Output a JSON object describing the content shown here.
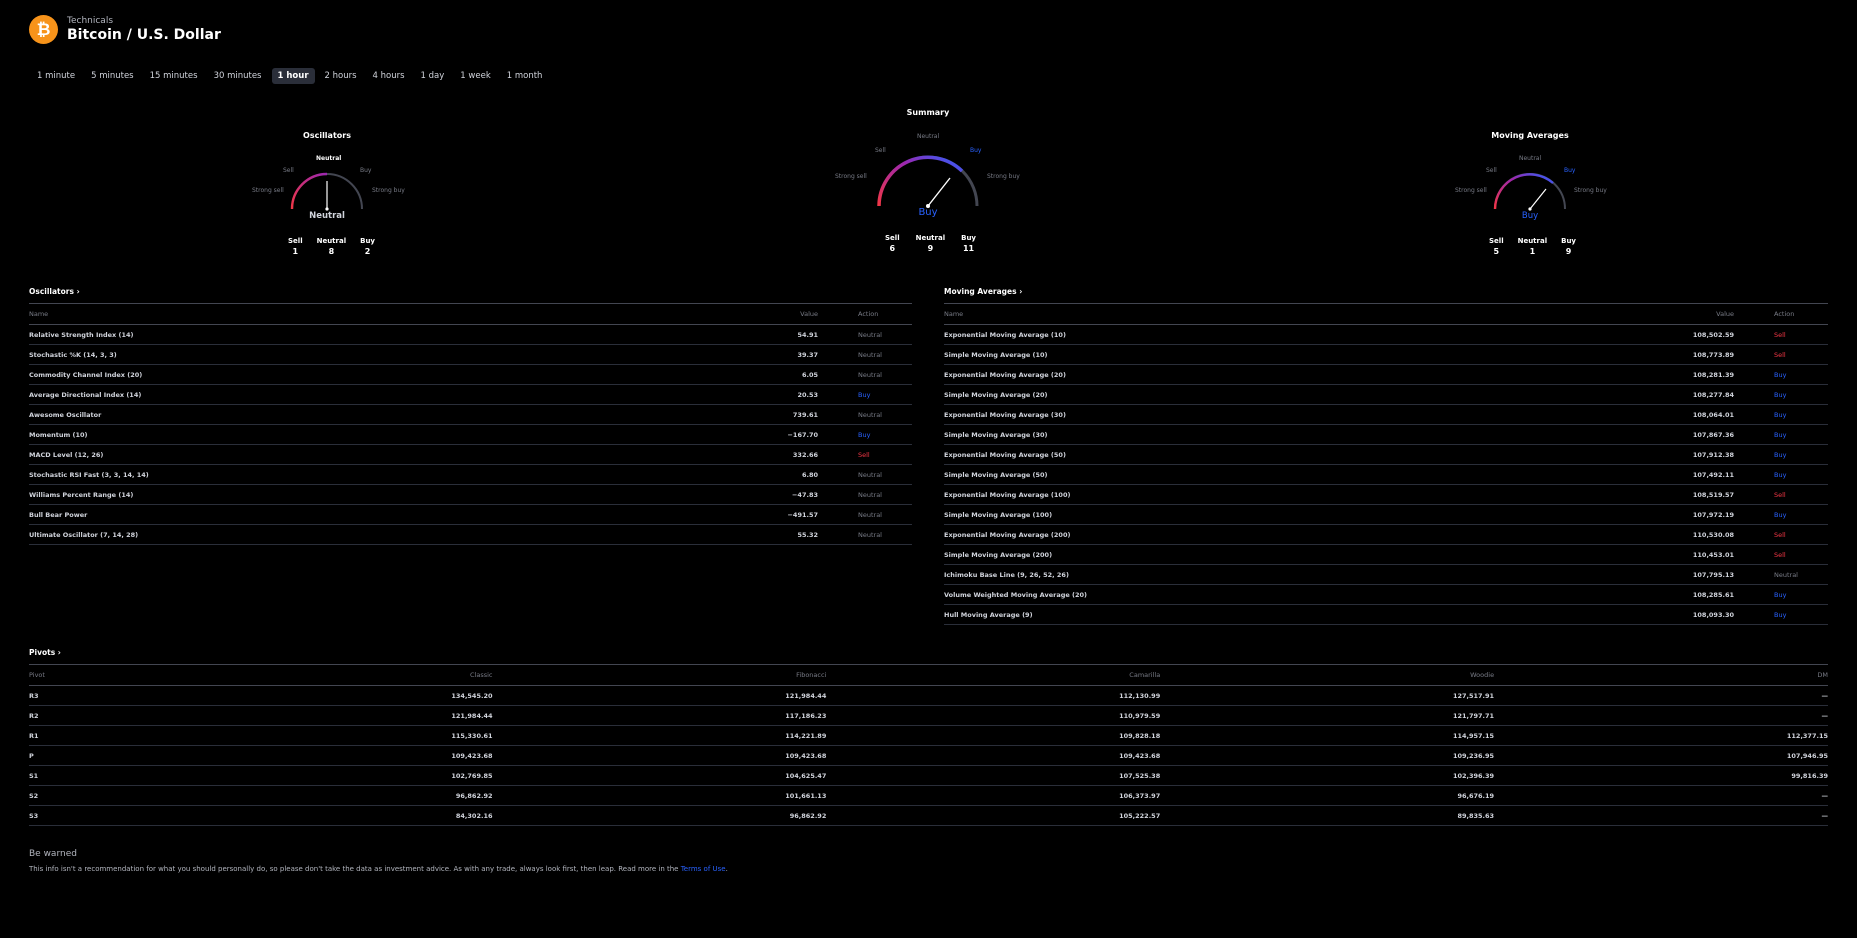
{
  "header": {
    "subtitle": "Technicals",
    "title": "Bitcoin / U.S. Dollar",
    "logo_glyph": "₿",
    "logo_color": "#f7931a"
  },
  "intervals": [
    "1 minute",
    "5 minutes",
    "15 minutes",
    "30 minutes",
    "1 hour",
    "2 hours",
    "4 hours",
    "1 day",
    "1 week",
    "1 month"
  ],
  "active_interval": "1 hour",
  "colors": {
    "buy": "#2962ff",
    "sell": "#f23645",
    "neutral": "#787b86"
  },
  "gauges": {
    "oscillators": {
      "title": "Oscillators",
      "result": "Neutral",
      "labels": {
        "strong_sell": "Strong sell",
        "sell": "Sell",
        "neutral": "Neutral",
        "buy": "Buy",
        "strong_buy": "Strong buy"
      },
      "counts": {
        "sell_label": "Sell",
        "sell": "1",
        "neutral_label": "Neutral",
        "neutral": "8",
        "buy_label": "Buy",
        "buy": "2"
      }
    },
    "summary": {
      "title": "Summary",
      "result": "Buy",
      "labels": {
        "strong_sell": "Strong sell",
        "sell": "Sell",
        "neutral": "Neutral",
        "buy": "Buy",
        "strong_buy": "Strong buy"
      },
      "counts": {
        "sell_label": "Sell",
        "sell": "6",
        "neutral_label": "Neutral",
        "neutral": "9",
        "buy_label": "Buy",
        "buy": "11"
      }
    },
    "moving_averages": {
      "title": "Moving Averages",
      "result": "Buy",
      "labels": {
        "strong_sell": "Strong sell",
        "sell": "Sell",
        "neutral": "Neutral",
        "buy": "Buy",
        "strong_buy": "Strong buy"
      },
      "counts": {
        "sell_label": "Sell",
        "sell": "5",
        "neutral_label": "Neutral",
        "neutral": "1",
        "buy_label": "Buy",
        "buy": "9"
      }
    }
  },
  "oscillators_table": {
    "title": "Oscillators ›",
    "headers": {
      "name": "Name",
      "value": "Value",
      "action": "Action"
    },
    "rows": [
      {
        "name": "Relative Strength Index (14)",
        "value": "54.91",
        "action": "Neutral"
      },
      {
        "name": "Stochastic %K (14, 3, 3)",
        "value": "39.37",
        "action": "Neutral"
      },
      {
        "name": "Commodity Channel Index (20)",
        "value": "6.05",
        "action": "Neutral"
      },
      {
        "name": "Average Directional Index (14)",
        "value": "20.53",
        "action": "Buy"
      },
      {
        "name": "Awesome Oscillator",
        "value": "739.61",
        "action": "Neutral"
      },
      {
        "name": "Momentum (10)",
        "value": "−167.70",
        "action": "Buy"
      },
      {
        "name": "MACD Level (12, 26)",
        "value": "332.66",
        "action": "Sell"
      },
      {
        "name": "Stochastic RSI Fast (3, 3, 14, 14)",
        "value": "6.80",
        "action": "Neutral"
      },
      {
        "name": "Williams Percent Range (14)",
        "value": "−47.83",
        "action": "Neutral"
      },
      {
        "name": "Bull Bear Power",
        "value": "−491.57",
        "action": "Neutral"
      },
      {
        "name": "Ultimate Oscillator (7, 14, 28)",
        "value": "55.32",
        "action": "Neutral"
      }
    ]
  },
  "ma_table": {
    "title": "Moving Averages ›",
    "headers": {
      "name": "Name",
      "value": "Value",
      "action": "Action"
    },
    "rows": [
      {
        "name": "Exponential Moving Average (10)",
        "value": "108,502.59",
        "action": "Sell"
      },
      {
        "name": "Simple Moving Average (10)",
        "value": "108,773.89",
        "action": "Sell"
      },
      {
        "name": "Exponential Moving Average (20)",
        "value": "108,281.39",
        "action": "Buy"
      },
      {
        "name": "Simple Moving Average (20)",
        "value": "108,277.84",
        "action": "Buy"
      },
      {
        "name": "Exponential Moving Average (30)",
        "value": "108,064.01",
        "action": "Buy"
      },
      {
        "name": "Simple Moving Average (30)",
        "value": "107,867.36",
        "action": "Buy"
      },
      {
        "name": "Exponential Moving Average (50)",
        "value": "107,912.38",
        "action": "Buy"
      },
      {
        "name": "Simple Moving Average (50)",
        "value": "107,492.11",
        "action": "Buy"
      },
      {
        "name": "Exponential Moving Average (100)",
        "value": "108,519.57",
        "action": "Sell"
      },
      {
        "name": "Simple Moving Average (100)",
        "value": "107,972.19",
        "action": "Buy"
      },
      {
        "name": "Exponential Moving Average (200)",
        "value": "110,530.08",
        "action": "Sell"
      },
      {
        "name": "Simple Moving Average (200)",
        "value": "110,453.01",
        "action": "Sell"
      },
      {
        "name": "Ichimoku Base Line (9, 26, 52, 26)",
        "value": "107,795.13",
        "action": "Neutral"
      },
      {
        "name": "Volume Weighted Moving Average (20)",
        "value": "108,285.61",
        "action": "Buy"
      },
      {
        "name": "Hull Moving Average (9)",
        "value": "108,093.30",
        "action": "Buy"
      }
    ]
  },
  "pivots_table": {
    "title": "Pivots ›",
    "headers": [
      "Pivot",
      "Classic",
      "Fibonacci",
      "Camarilla",
      "Woodie",
      "DM"
    ],
    "rows": [
      [
        "R3",
        "134,545.20",
        "121,984.44",
        "112,130.99",
        "127,517.91",
        "—"
      ],
      [
        "R2",
        "121,984.44",
        "117,186.23",
        "110,979.59",
        "121,797.71",
        "—"
      ],
      [
        "R1",
        "115,330.61",
        "114,221.89",
        "109,828.18",
        "114,957.15",
        "112,377.15"
      ],
      [
        "P",
        "109,423.68",
        "109,423.68",
        "109,423.68",
        "109,236.95",
        "107,946.95"
      ],
      [
        "S1",
        "102,769.85",
        "104,625.47",
        "107,525.38",
        "102,396.39",
        "99,816.39"
      ],
      [
        "S2",
        "96,862.92",
        "101,661.13",
        "106,373.97",
        "96,676.19",
        "—"
      ],
      [
        "S3",
        "84,302.16",
        "96,862.92",
        "105,222.57",
        "89,835.63",
        "—"
      ]
    ]
  },
  "warning": {
    "title": "Be warned",
    "text": "This info isn't a recommendation for what you should personally do, so please don't take the data as investment advice. As with any trade, always look first, then leap. Read more in the ",
    "link": "Terms of Use",
    "end": "."
  }
}
